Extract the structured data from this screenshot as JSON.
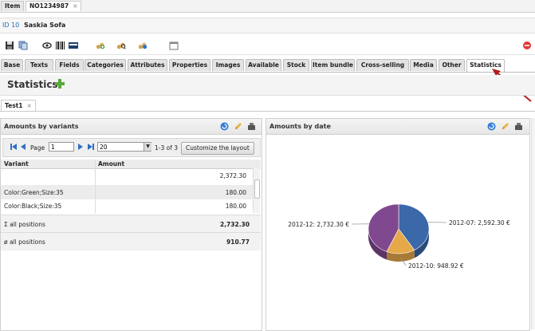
{
  "doc_tabs": [
    {
      "label": "Item",
      "active": false
    },
    {
      "label": "NO1234987",
      "active": true,
      "close": "×"
    }
  ],
  "header": {
    "id": "ID 10",
    "name": "Saskia Sofa"
  },
  "toolbar_icons": [
    "save-icon",
    "copy-icon",
    "eye-icon",
    "barcode-icon",
    "ean-icon",
    "item-add-icon",
    "item-search-icon",
    "item-web-icon",
    "calendar-icon",
    "close-red-icon"
  ],
  "property_tabs": [
    {
      "label": "Base"
    },
    {
      "label": "Texts"
    },
    {
      "label": "Fields"
    },
    {
      "label": "Categories"
    },
    {
      "label": "Attributes"
    },
    {
      "label": "Properties"
    },
    {
      "label": "Images"
    },
    {
      "label": "Available"
    },
    {
      "label": "Stock"
    },
    {
      "label": "Item bundle"
    },
    {
      "label": "Cross-selling"
    },
    {
      "label": "Media"
    },
    {
      "label": "Other"
    },
    {
      "label": "Statistics",
      "active": true
    }
  ],
  "statistics": {
    "title": "Statistics",
    "subtab": "Test1",
    "subtab_close": "×"
  },
  "variants_panel": {
    "title": "Amounts by variants",
    "pager": {
      "page_label": "Page",
      "page_value": "1",
      "page_size": "20",
      "range": "1-3 of 3",
      "customize": "Customize the layout"
    },
    "columns": [
      "Variant",
      "Amount"
    ],
    "rows": [
      {
        "variant": "",
        "amount": "2,372.30"
      },
      {
        "variant": "Color:Green;Size:35",
        "amount": "180.00"
      },
      {
        "variant": "Color:Black;Size:35",
        "amount": "180.00"
      }
    ],
    "totals": [
      {
        "label": "Σ all positions",
        "value": "2,732.30"
      },
      {
        "label": "ø all positions",
        "value": "910.77"
      }
    ]
  },
  "date_panel": {
    "title": "Amounts by date"
  },
  "chart_data": {
    "type": "pie",
    "title": "",
    "labels": [
      "2012-07",
      "2012-10",
      "2012-12"
    ],
    "values": [
      2592.3,
      948.92,
      2732.3
    ],
    "data_labels": [
      "2012-07: 2,592.30 €",
      "2012-10: 948.92 €",
      "2012-12: 2,732.30 €"
    ],
    "colors": [
      "#3b68a8",
      "#e6a94a",
      "#80488f"
    ]
  },
  "colors": {
    "accent": "#2a6fb3",
    "arrow": "#b01c1c"
  }
}
